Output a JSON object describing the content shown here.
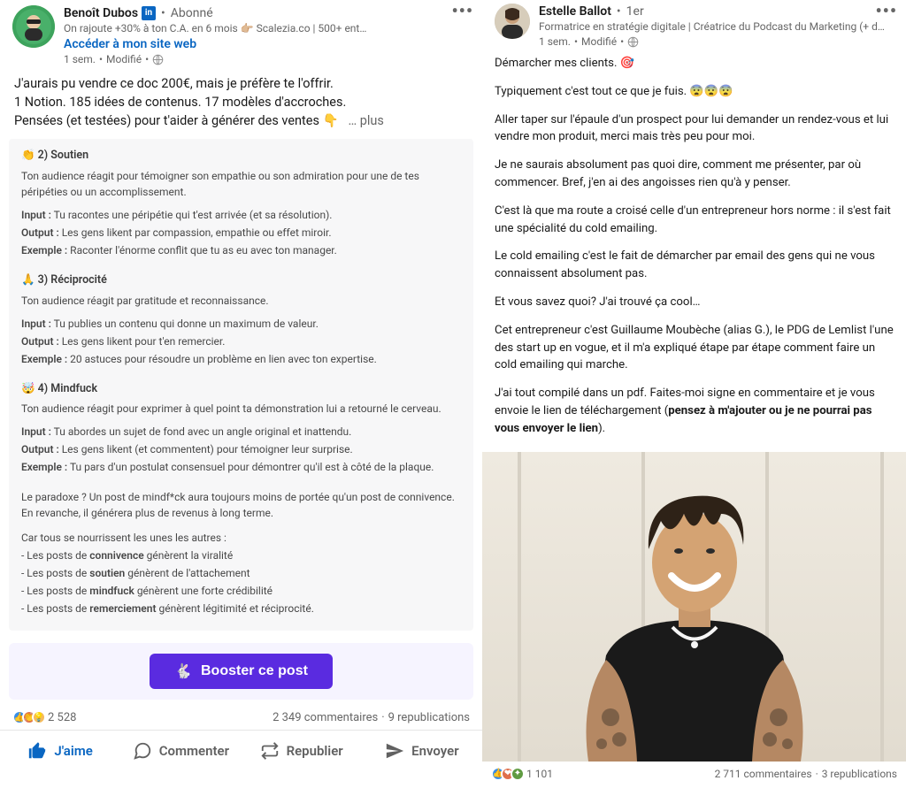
{
  "left": {
    "author": {
      "name": "Benoît Dubos",
      "relation": "Abonné",
      "headline": "On rajoute +30% à ton C.A. en 6 mois 👉🏼 Scalezia.co | 500+ ent…",
      "promoted_link": "Accéder à mon site web",
      "time": "1 sem.",
      "modified": "Modifié"
    },
    "body": {
      "line1": "J'aurais pu vendre ce doc 200€, mais je préfère te l'offrir.",
      "line2": "1 Notion. 185 idées de contenus. 17 modèles d'accroches.",
      "line3_prefix": "Pensées (et testées) pour t'aider à générer des ventes 👇",
      "see_more": "… plus"
    },
    "doc": {
      "s2": {
        "title": "👏 2) Soutien",
        "intro": "Ton audience réagit pour témoigner son empathie ou son admiration pour une de tes péripéties ou un accomplissement.",
        "input_lbl": "Input :",
        "input": "Tu racontes une péripétie qui t'est arrivée (et sa résolution).",
        "output_lbl": "Output :",
        "output": "Les gens likent par compassion, empathie ou effet miroir.",
        "example_lbl": "Exemple :",
        "example": "Raconter l'énorme conflit que tu as eu avec ton manager."
      },
      "s3": {
        "title": "🙏 3) Réciprocité",
        "intro": "Ton audience réagit par gratitude et reconnaissance.",
        "input_lbl": "Input :",
        "input": "Tu publies un contenu qui donne un maximum de valeur.",
        "output_lbl": "Output :",
        "output": "Les gens likent pour t'en remercier.",
        "example_lbl": "Exemple :",
        "example": "20 astuces pour résoudre un problème en lien avec ton expertise."
      },
      "s4": {
        "title": "🤯 4) Mindfuck",
        "intro": "Ton audience réagit pour exprimer à quel point ta démonstration lui a retourné le cerveau.",
        "input_lbl": "Input :",
        "input": "Tu abordes un sujet de fond avec un angle original et inattendu.",
        "output_lbl": "Output :",
        "output": "Les gens likent (et commentent) pour témoigner leur surprise.",
        "example_lbl": "Exemple :",
        "example": "Tu pars d'un postulat consensuel pour démontrer qu'il est à côté de la plaque."
      },
      "paradox": "Le paradoxe ? Un post de mindf*ck aura toujours moins de portée qu'un post de connivence. En revanche, il générera plus de revenus à long terme.",
      "list_intro": "Car tous se nourrissent les unes les autres :",
      "li1a": "- Les posts de ",
      "li1b": "connivence",
      "li1c": " génèrent la viralité",
      "li2a": "- Les posts de ",
      "li2b": "soutien",
      "li2c": " génèrent de l'attachement",
      "li3a": "- Les posts de ",
      "li3b": "mindfuck",
      "li3c": " génèrent une forte crédibilité",
      "li4a": "- Les posts de ",
      "li4b": "remerciement",
      "li4c": " génèrent légitimité et réciprocité."
    },
    "boost_label": "Booster ce post",
    "stats": {
      "reactions": "2 528",
      "comments": "2 349 commentaires",
      "reposts": "9 republications"
    },
    "actions": {
      "like": "J'aime",
      "comment": "Commenter",
      "repost": "Republier",
      "send": "Envoyer"
    }
  },
  "right": {
    "author": {
      "name": "Estelle Ballot",
      "degree": "1er",
      "headline": "Formatrice en stratégie digitale | Créatrice du Podcast du Marketing (+ d…",
      "time": "1 sem.",
      "modified": "Modifié"
    },
    "body": {
      "p1": "Démarcher mes clients. 🎯",
      "p2": "Typiquement c'est tout ce que je fuis. 😨😨😨",
      "p3": "Aller taper sur l'épaule d'un prospect pour lui demander un rendez-vous et lui vendre mon produit, merci mais très peu pour moi.",
      "p4": "Je ne saurais absolument pas quoi dire, comment me présenter, par où commencer. Bref, j'en ai des angoisses rien qu'à y penser.",
      "p5": "C'est là que ma route a croisé celle d'un entrepreneur hors norme : il s'est fait une spécialité du cold emailing.",
      "p6": "Le cold emailing c'est le fait de démarcher par email des gens qui ne vous connaissent absolument pas.",
      "p7": "Et vous savez quoi? J'ai trouvé ça cool…",
      "p8": "Cet entrepreneur c'est Guillaume Moubèche (alias G.), le PDG de Lemlist l'une des start up en vogue, et il m'a expliqué étape par étape comment faire un cold emailing qui marche.",
      "p9a": "J'ai tout compilé dans un pdf. Faites-moi signe en commentaire et je vous envoie le lien de téléchargement (",
      "p9b": "pensez à m'ajouter ou je ne pourrai pas vous envoyer le lien",
      "p9c": ")."
    },
    "stats": {
      "reactions": "1 101",
      "comments": "2 711 commentaires",
      "reposts": "3 republications"
    }
  }
}
